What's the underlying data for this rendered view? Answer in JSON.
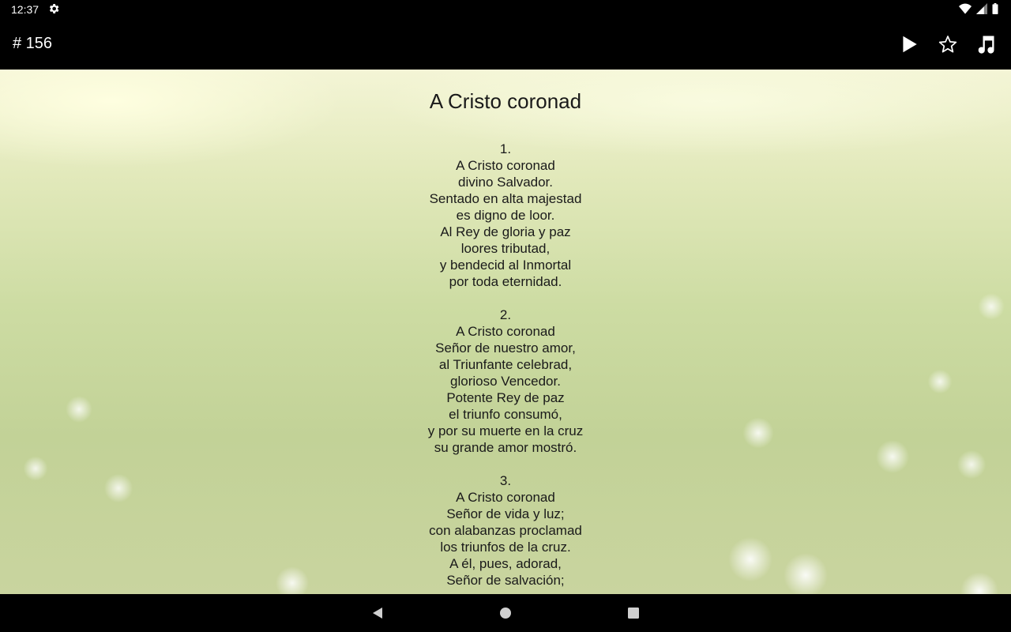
{
  "status_bar": {
    "time": "12:37"
  },
  "app_bar": {
    "title": "# 156",
    "actions": [
      "play-icon",
      "star-outline-icon",
      "music-note-icon"
    ]
  },
  "hymn": {
    "title": "A Cristo coronad",
    "verses": [
      {
        "number": "1.",
        "lines": [
          "A Cristo coronad",
          "divino Salvador.",
          "Sentado en alta majestad",
          "es digno de loor.",
          "Al Rey de gloria y paz",
          "loores tributad,",
          "y bendecid al Inmortal",
          "por toda eternidad."
        ]
      },
      {
        "number": "2.",
        "lines": [
          "A Cristo coronad",
          "Señor de nuestro amor,",
          "al Triunfante celebrad,",
          "glorioso Vencedor.",
          "Potente Rey de paz",
          "el triunfo consumó,",
          "y por su muerte en la cruz",
          "su grande amor mostró."
        ]
      },
      {
        "number": "3.",
        "lines": [
          "A Cristo coronad",
          "Señor de vida y luz;",
          "con alabanzas proclamad",
          "los triunfos de la cruz.",
          "A él, pues, adorad,",
          "Señor de salvación;"
        ]
      }
    ]
  },
  "nav_bar": {
    "buttons": [
      "back-icon",
      "home-icon",
      "recents-icon"
    ]
  }
}
